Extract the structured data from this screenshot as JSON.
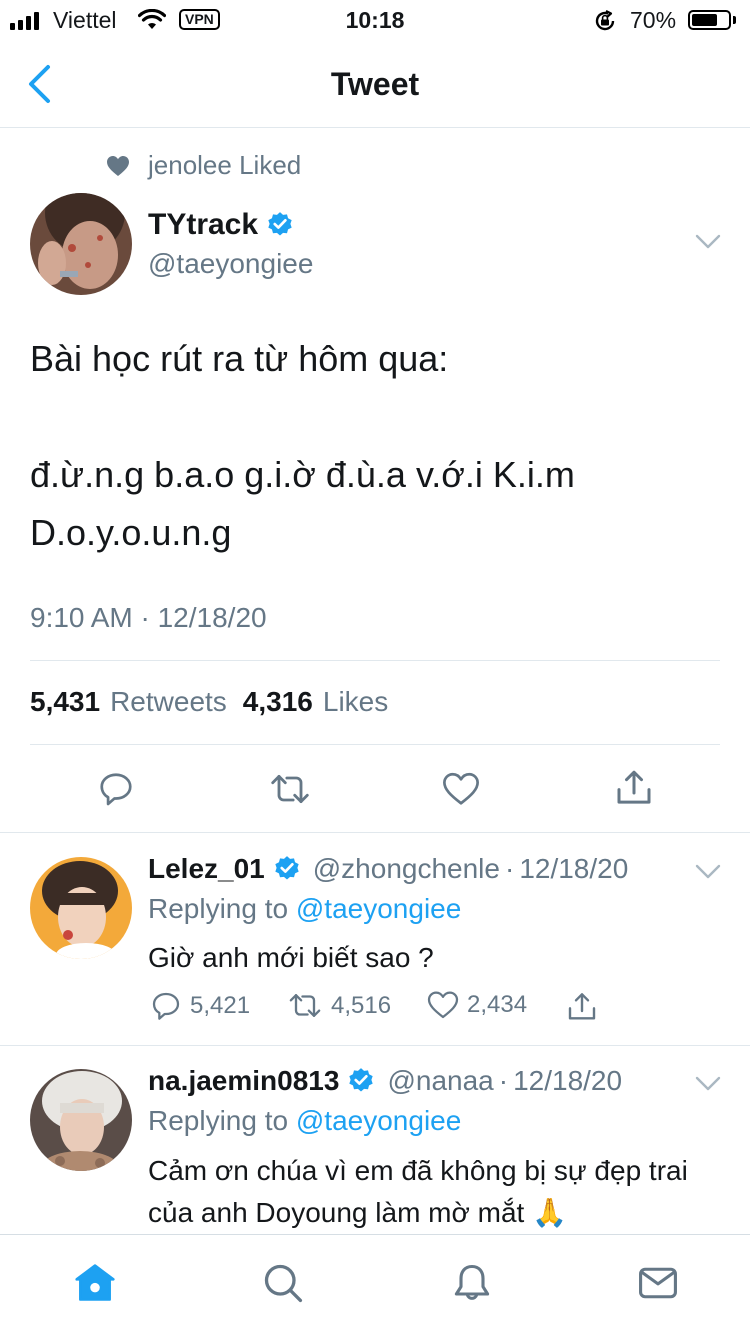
{
  "status_bar": {
    "carrier": "Viettel",
    "vpn": "VPN",
    "time": "10:18",
    "battery_percent_text": "70%",
    "battery_level": 0.7
  },
  "nav": {
    "title": "Tweet"
  },
  "tweet": {
    "social_context": "jenolee Liked",
    "author_name": "TYtrack",
    "author_handle": "@taeyongiee",
    "body": "Bài học rút ra từ hôm qua:\n\nđ.ừ.n.g b.a.o g.i.ờ đ.ù.a v.ớ.i K.i.m\nD.o.y.o.u.n.g",
    "timestamp": "9:10 AM · 12/18/20",
    "retweets_count": "5,431",
    "retweets_label": "Retweets",
    "likes_count": "4,316",
    "likes_label": "Likes"
  },
  "replies": [
    {
      "name": "Lelez_01",
      "handle": "@zhongchenle",
      "date": "12/18/20",
      "replying_prefix": "Replying to",
      "replying_to": "@taeyongiee",
      "text": "Giờ anh mới biết sao ?",
      "reply_count": "5,421",
      "retweet_count": "4,516",
      "like_count": "2,434"
    },
    {
      "name": "na.jaemin0813",
      "handle": "@nanaa",
      "date": "12/18/20",
      "replying_prefix": "Replying to",
      "replying_to": "@taeyongiee",
      "text": "Cảm ơn chúa vì em đã không bị sự đẹp trai của anh Doyoung làm mờ mắt 🙏"
    }
  ],
  "colors": {
    "accent": "#1da1f2",
    "secondary_text": "#657786",
    "primary_text": "#14171a",
    "divider": "#e1e8ed",
    "icon_gray": "#657786"
  },
  "icons": {
    "back": "chevron-left-icon",
    "liked_context": "heart-filled-icon",
    "verified": "verified-badge-icon",
    "more": "chevron-down-icon",
    "reply": "reply-icon",
    "retweet": "retweet-icon",
    "like": "heart-icon",
    "share": "share-icon",
    "tabs": [
      "home-icon",
      "search-icon",
      "notifications-icon",
      "messages-icon"
    ]
  }
}
